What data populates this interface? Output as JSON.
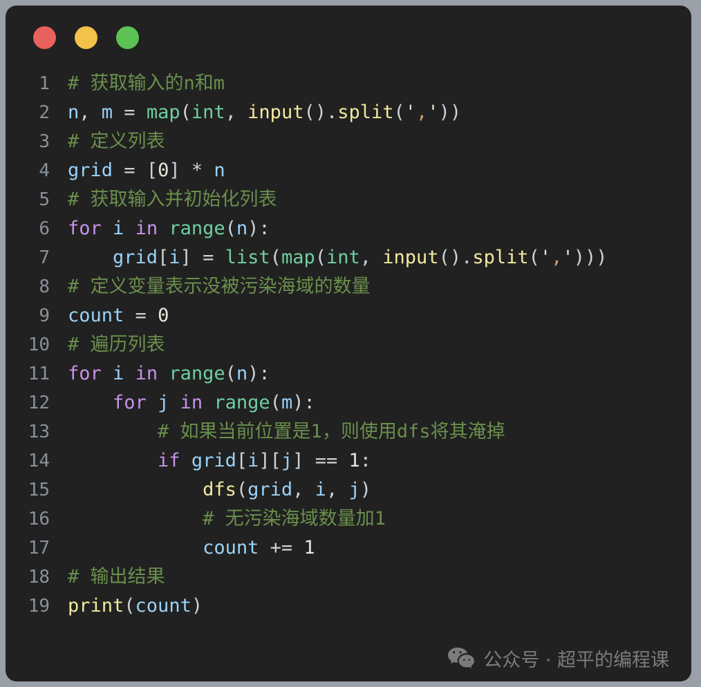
{
  "window": {
    "controls": [
      {
        "name": "close",
        "color": "#e8615c"
      },
      {
        "name": "minimize",
        "color": "#f3c24a"
      },
      {
        "name": "maximize",
        "color": "#5cc254"
      }
    ]
  },
  "editor": {
    "language": "python",
    "background": "#212121",
    "gutter_color": "#8a9199",
    "theme_colors": {
      "comment": "#6a8f4c",
      "keyword": "#c792ea",
      "variable": "#9bd2f8",
      "function": "#6fcfa0",
      "builtin": "#f2eaa0",
      "punctuation": "#cfd3d6",
      "number": "#e7e7dd",
      "string": "#e2e2cd"
    },
    "lines": [
      {
        "no": "1",
        "text": "# 获取输入的n和m"
      },
      {
        "no": "2",
        "text": "n, m = map(int, input().split(','))"
      },
      {
        "no": "3",
        "text": "# 定义列表"
      },
      {
        "no": "4",
        "text": "grid = [0] * n"
      },
      {
        "no": "5",
        "text": "# 获取输入并初始化列表"
      },
      {
        "no": "6",
        "text": "for i in range(n):"
      },
      {
        "no": "7",
        "text": "    grid[i] = list(map(int, input().split(',')))"
      },
      {
        "no": "8",
        "text": "# 定义变量表示没被污染海域的数量"
      },
      {
        "no": "9",
        "text": "count = 0"
      },
      {
        "no": "10",
        "text": "# 遍历列表"
      },
      {
        "no": "11",
        "text": "for i in range(n):"
      },
      {
        "no": "12",
        "text": "    for j in range(m):"
      },
      {
        "no": "13",
        "text": "        # 如果当前位置是1，则使用dfs将其淹掉"
      },
      {
        "no": "14",
        "text": "        if grid[i][j] == 1:"
      },
      {
        "no": "15",
        "text": "            dfs(grid, i, j)"
      },
      {
        "no": "16",
        "text": "            # 无污染海域数量加1"
      },
      {
        "no": "17",
        "text": "            count += 1"
      },
      {
        "no": "18",
        "text": "# 输出结果"
      },
      {
        "no": "19",
        "text": "print(count)"
      }
    ],
    "tokens": [
      [
        {
          "c": "t-comment",
          "s": "# 获取输入的n和m"
        }
      ],
      [
        {
          "c": "t-var",
          "s": "n"
        },
        {
          "c": "t-punc",
          "s": ", "
        },
        {
          "c": "t-var",
          "s": "m"
        },
        {
          "c": "t-op",
          "s": " = "
        },
        {
          "c": "t-fn",
          "s": "map"
        },
        {
          "c": "t-punc",
          "s": "("
        },
        {
          "c": "t-fn",
          "s": "int"
        },
        {
          "c": "t-punc",
          "s": ", "
        },
        {
          "c": "t-builtin",
          "s": "input"
        },
        {
          "c": "t-punc",
          "s": "()."
        },
        {
          "c": "t-builtin",
          "s": "split"
        },
        {
          "c": "t-punc",
          "s": "("
        },
        {
          "c": "t-str",
          "s": "'"
        },
        {
          "c": "t-comma",
          "s": ","
        },
        {
          "c": "t-str",
          "s": "'"
        },
        {
          "c": "t-punc",
          "s": "))"
        }
      ],
      [
        {
          "c": "t-comment",
          "s": "# 定义列表"
        }
      ],
      [
        {
          "c": "t-var",
          "s": "grid"
        },
        {
          "c": "t-op",
          "s": " = "
        },
        {
          "c": "t-punc",
          "s": "["
        },
        {
          "c": "t-num",
          "s": "0"
        },
        {
          "c": "t-punc",
          "s": "]"
        },
        {
          "c": "t-op",
          "s": " * "
        },
        {
          "c": "t-var",
          "s": "n"
        }
      ],
      [
        {
          "c": "t-comment",
          "s": "# 获取输入并初始化列表"
        }
      ],
      [
        {
          "c": "t-kw",
          "s": "for"
        },
        {
          "c": "t-punc",
          "s": " "
        },
        {
          "c": "t-var",
          "s": "i"
        },
        {
          "c": "t-punc",
          "s": " "
        },
        {
          "c": "t-kw",
          "s": "in"
        },
        {
          "c": "t-punc",
          "s": " "
        },
        {
          "c": "t-fn",
          "s": "range"
        },
        {
          "c": "t-punc",
          "s": "("
        },
        {
          "c": "t-var",
          "s": "n"
        },
        {
          "c": "t-punc",
          "s": "):"
        }
      ],
      [
        {
          "c": "t-punc",
          "s": "    "
        },
        {
          "c": "t-var",
          "s": "grid"
        },
        {
          "c": "t-punc",
          "s": "["
        },
        {
          "c": "t-var",
          "s": "i"
        },
        {
          "c": "t-punc",
          "s": "]"
        },
        {
          "c": "t-op",
          "s": " = "
        },
        {
          "c": "t-fn",
          "s": "list"
        },
        {
          "c": "t-punc",
          "s": "("
        },
        {
          "c": "t-fn",
          "s": "map"
        },
        {
          "c": "t-punc",
          "s": "("
        },
        {
          "c": "t-fn",
          "s": "int"
        },
        {
          "c": "t-punc",
          "s": ", "
        },
        {
          "c": "t-builtin",
          "s": "input"
        },
        {
          "c": "t-punc",
          "s": "()."
        },
        {
          "c": "t-builtin",
          "s": "split"
        },
        {
          "c": "t-punc",
          "s": "("
        },
        {
          "c": "t-str",
          "s": "'"
        },
        {
          "c": "t-comma",
          "s": ","
        },
        {
          "c": "t-str",
          "s": "'"
        },
        {
          "c": "t-punc",
          "s": ")))"
        }
      ],
      [
        {
          "c": "t-comment",
          "s": "# 定义变量表示没被污染海域的数量"
        }
      ],
      [
        {
          "c": "t-var",
          "s": "count"
        },
        {
          "c": "t-op",
          "s": " = "
        },
        {
          "c": "t-num",
          "s": "0"
        }
      ],
      [
        {
          "c": "t-comment",
          "s": "# 遍历列表"
        }
      ],
      [
        {
          "c": "t-kw",
          "s": "for"
        },
        {
          "c": "t-punc",
          "s": " "
        },
        {
          "c": "t-var",
          "s": "i"
        },
        {
          "c": "t-punc",
          "s": " "
        },
        {
          "c": "t-kw",
          "s": "in"
        },
        {
          "c": "t-punc",
          "s": " "
        },
        {
          "c": "t-fn",
          "s": "range"
        },
        {
          "c": "t-punc",
          "s": "("
        },
        {
          "c": "t-var",
          "s": "n"
        },
        {
          "c": "t-punc",
          "s": "):"
        }
      ],
      [
        {
          "c": "t-punc",
          "s": "    "
        },
        {
          "c": "t-kw",
          "s": "for"
        },
        {
          "c": "t-punc",
          "s": " "
        },
        {
          "c": "t-var",
          "s": "j"
        },
        {
          "c": "t-punc",
          "s": " "
        },
        {
          "c": "t-kw",
          "s": "in"
        },
        {
          "c": "t-punc",
          "s": " "
        },
        {
          "c": "t-fn",
          "s": "range"
        },
        {
          "c": "t-punc",
          "s": "("
        },
        {
          "c": "t-var",
          "s": "m"
        },
        {
          "c": "t-punc",
          "s": "):"
        }
      ],
      [
        {
          "c": "t-punc",
          "s": "        "
        },
        {
          "c": "t-comment",
          "s": "# 如果当前位置是1，则使用dfs将其淹掉"
        }
      ],
      [
        {
          "c": "t-punc",
          "s": "        "
        },
        {
          "c": "t-kw",
          "s": "if"
        },
        {
          "c": "t-punc",
          "s": " "
        },
        {
          "c": "t-var",
          "s": "grid"
        },
        {
          "c": "t-punc",
          "s": "["
        },
        {
          "c": "t-var",
          "s": "i"
        },
        {
          "c": "t-punc",
          "s": "]["
        },
        {
          "c": "t-var",
          "s": "j"
        },
        {
          "c": "t-punc",
          "s": "]"
        },
        {
          "c": "t-op",
          "s": " == "
        },
        {
          "c": "t-num",
          "s": "1"
        },
        {
          "c": "t-punc",
          "s": ":"
        }
      ],
      [
        {
          "c": "t-punc",
          "s": "            "
        },
        {
          "c": "t-builtin",
          "s": "dfs"
        },
        {
          "c": "t-punc",
          "s": "("
        },
        {
          "c": "t-var",
          "s": "grid"
        },
        {
          "c": "t-punc",
          "s": ", "
        },
        {
          "c": "t-var",
          "s": "i"
        },
        {
          "c": "t-punc",
          "s": ", "
        },
        {
          "c": "t-var",
          "s": "j"
        },
        {
          "c": "t-punc",
          "s": ")"
        }
      ],
      [
        {
          "c": "t-punc",
          "s": "            "
        },
        {
          "c": "t-comment",
          "s": "# 无污染海域数量加1"
        }
      ],
      [
        {
          "c": "t-punc",
          "s": "            "
        },
        {
          "c": "t-var",
          "s": "count"
        },
        {
          "c": "t-op",
          "s": " += "
        },
        {
          "c": "t-num",
          "s": "1"
        }
      ],
      [
        {
          "c": "t-comment",
          "s": "# 输出结果"
        }
      ],
      [
        {
          "c": "t-builtin",
          "s": "print"
        },
        {
          "c": "t-punc",
          "s": "("
        },
        {
          "c": "t-var",
          "s": "count"
        },
        {
          "c": "t-punc",
          "s": ")"
        }
      ]
    ]
  },
  "watermark": {
    "icon": "wechat-icon",
    "text": "公众号 · 超平的编程课"
  }
}
